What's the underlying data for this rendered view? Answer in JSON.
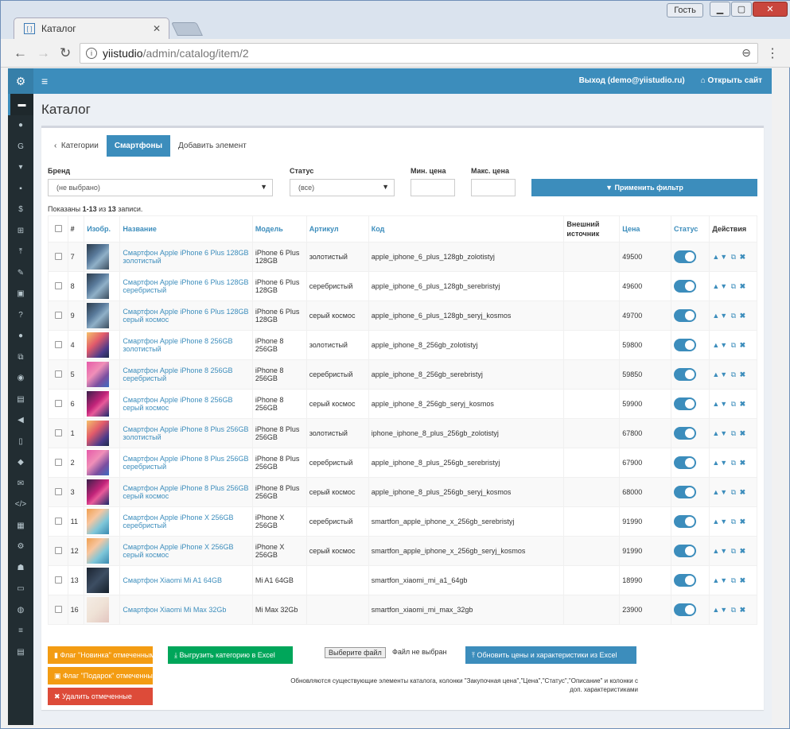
{
  "browser": {
    "tab_title": "Каталог",
    "tab_favicon": "[ ]",
    "profile": "Гость",
    "url_host": "yiistudio",
    "url_path": "/admin/catalog/item/2"
  },
  "topnav": {
    "logout": "Выход (demo@yiistudio.ru)",
    "open_site": "Открыть сайт"
  },
  "page_title": "Каталог",
  "tabs": {
    "back": "Категории",
    "active": "Смартфоны",
    "add": "Добавить элемент"
  },
  "filters": {
    "brand_label": "Бренд",
    "brand_value": "(не выбрано)",
    "status_label": "Статус",
    "status_value": "(все)",
    "min_price_label": "Мин. цена",
    "max_price_label": "Макс. цена",
    "apply": "Применить фильтр"
  },
  "summary": {
    "prefix": "Показаны ",
    "range": "1-13",
    "middle": " из ",
    "total": "13",
    "suffix": " записи."
  },
  "table": {
    "headers": {
      "id": "#",
      "image": "Изобр.",
      "name": "Название",
      "model": "Модель",
      "article": "Артикул",
      "code": "Код",
      "external": "Внешний источник",
      "price": "Цена",
      "status": "Статус",
      "actions": "Действия"
    },
    "rows": [
      {
        "id": "7",
        "name": "Смартфон Apple iPhone 6 Plus 128GB золотистый",
        "model": "iPhone 6 Plus 128GB",
        "article": "золотистый",
        "code": "apple_iphone_6_plus_128gb_zolotistyj",
        "price": "49500",
        "img": "iphone6"
      },
      {
        "id": "8",
        "name": "Смартфон Apple iPhone 6 Plus 128GB серебристый",
        "model": "iPhone 6 Plus 128GB",
        "article": "серебристый",
        "code": "apple_iphone_6_plus_128gb_serebristyj",
        "price": "49600",
        "img": "iphone6"
      },
      {
        "id": "9",
        "name": "Смартфон Apple iPhone 6 Plus 128GB серый космос",
        "model": "iPhone 6 Plus 128GB",
        "article": "серый космос",
        "code": "apple_iphone_6_plus_128gb_seryj_kosmos",
        "price": "49700",
        "img": "iphone6"
      },
      {
        "id": "4",
        "name": "Смартфон Apple iPhone 8 256GB золотистый",
        "model": "iPhone 8 256GB",
        "article": "золотистый",
        "code": "apple_iphone_8_256gb_zolotistyj",
        "price": "59800",
        "img": "iphone8a"
      },
      {
        "id": "5",
        "name": "Смартфон Apple iPhone 8 256GB серебристый",
        "model": "iPhone 8 256GB",
        "article": "серебристый",
        "code": "apple_iphone_8_256gb_serebristyj",
        "price": "59850",
        "img": "iphone8b"
      },
      {
        "id": "6",
        "name": "Смартфон Apple iPhone 8 256GB серый космос",
        "model": "iPhone 8 256GB",
        "article": "серый космос",
        "code": "apple_iphone_8_256gb_seryj_kosmos",
        "price": "59900",
        "img": "iphone8c"
      },
      {
        "id": "1",
        "name": "Смартфон Apple iPhone 8 Plus 256GB золотистый",
        "model": "iPhone 8 Plus 256GB",
        "article": "золотистый",
        "code": "iphone_iphone_8_plus_256gb_zolotistyj",
        "price": "67800",
        "img": "iphone8a"
      },
      {
        "id": "2",
        "name": "Смартфон Apple iPhone 8 Plus 256GB серебристый",
        "model": "iPhone 8 Plus 256GB",
        "article": "серебристый",
        "code": "apple_iphone_8_plus_256gb_serebristyj",
        "price": "67900",
        "img": "iphone8b"
      },
      {
        "id": "3",
        "name": "Смартфон Apple iPhone 8 Plus 256GB серый космос",
        "model": "iPhone 8 Plus 256GB",
        "article": "серый космос",
        "code": "apple_iphone_8_plus_256gb_seryj_kosmos",
        "price": "68000",
        "img": "iphone8c"
      },
      {
        "id": "11",
        "name": "Смартфон Apple iPhone X 256GB серебристый",
        "model": "iPhone X 256GB",
        "article": "серебристый",
        "code": "smartfon_apple_iphone_x_256gb_serebristyj",
        "price": "91990",
        "img": "iphonex"
      },
      {
        "id": "12",
        "name": "Смартфон Apple iPhone X 256GB серый космос",
        "model": "iPhone X 256GB",
        "article": "серый космос",
        "code": "smartfon_apple_iphone_x_256gb_seryj_kosmos",
        "price": "91990",
        "img": "iphonex"
      },
      {
        "id": "13",
        "name": "Смартфон Xiaomi Mi A1 64GB",
        "model": "Mi A1 64GB",
        "article": "",
        "code": "smartfon_xiaomi_mi_a1_64gb",
        "price": "18990",
        "img": "xiaomi1"
      },
      {
        "id": "16",
        "name": "Смартфон Xiaomi Mi Max 32Gb",
        "model": "Mi Max 32Gb",
        "article": "",
        "code": "smartfon_xiaomi_mi_max_32gb",
        "price": "23900",
        "img": "xiaomi2"
      }
    ]
  },
  "bottom": {
    "flag_new": "Флаг \"Новинка\" отмеченным",
    "flag_gift": "Флаг \"Подарок\" отмеченным",
    "delete": "Удалить отмеченные",
    "export": "Выгрузить категорию в Excel",
    "choose_file": "Выберите файл",
    "no_file": "Файл не выбран",
    "update": "Обновить цены и характеристики из Excel",
    "note": "Обновляются существующие элементы каталога, колонки \"Закупочная цена\",\"Цена\",\"Статус\",\"Описание\" и колонки с доп. характеристиками"
  },
  "colors": {
    "primary": "#3c8dbc",
    "sidebar": "#222d32",
    "orange": "#f39c12",
    "red": "#dd4b39",
    "green": "#00a65a"
  },
  "sidebar_icons": [
    "dashboard-icon",
    "comments-icon",
    "google-icon",
    "cart-icon",
    "truck-icon",
    "dollar-icon",
    "sitemap-icon",
    "upload-icon",
    "pencil-icon",
    "image-icon",
    "question-icon",
    "chat-icon",
    "copy-icon",
    "camera-icon",
    "book-icon",
    "bullhorn-icon",
    "file-icon",
    "tags-icon",
    "envelope-icon",
    "code-icon",
    "grid-icon",
    "gear-icon",
    "users-icon",
    "drive-icon",
    "globe-icon",
    "list-icon",
    "database-icon"
  ]
}
